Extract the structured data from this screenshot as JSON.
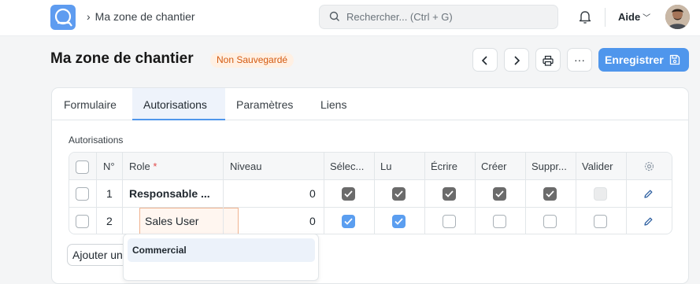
{
  "navbar": {
    "breadcrumb": "Ma zone de chantier",
    "search_placeholder": "Rechercher... (Ctrl + G)",
    "help_label": "Aide"
  },
  "header": {
    "title": "Ma zone de chantier",
    "status_badge": "Non Sauvegardé",
    "save_label": "Enregistrer",
    "more_label": "···"
  },
  "tabs": [
    {
      "label": "Formulaire",
      "active": false
    },
    {
      "label": "Autorisations",
      "active": true
    },
    {
      "label": "Paramètres",
      "active": false
    },
    {
      "label": "Liens",
      "active": false
    }
  ],
  "permissions": {
    "section_label": "Autorisations",
    "columns": [
      "N°",
      "Role",
      "Niveau",
      "Sélec...",
      "Lu",
      "Écrire",
      "Créer",
      "Suppr...",
      "Valider"
    ],
    "required_marker": "*",
    "rows": [
      {
        "no": "1",
        "role": "Responsable ...",
        "level": "0",
        "select": true,
        "read": true,
        "write": true,
        "create": true,
        "delete": true,
        "submit": false,
        "style": "saved"
      },
      {
        "no": "2",
        "role": "Sales User",
        "level": "0",
        "select": true,
        "read": true,
        "write": false,
        "create": false,
        "delete": false,
        "submit": false,
        "style": "editing"
      }
    ],
    "add_row_label": "Ajouter une ligne"
  },
  "dropdown": {
    "items": [
      "Commercial"
    ]
  },
  "colors": {
    "accent": "#4f96ec",
    "badge_text": "#d45a10",
    "badge_bg": "#fff0e3",
    "checked_saved": "#6b6b6b",
    "checked_editing": "#5b9ef0"
  }
}
